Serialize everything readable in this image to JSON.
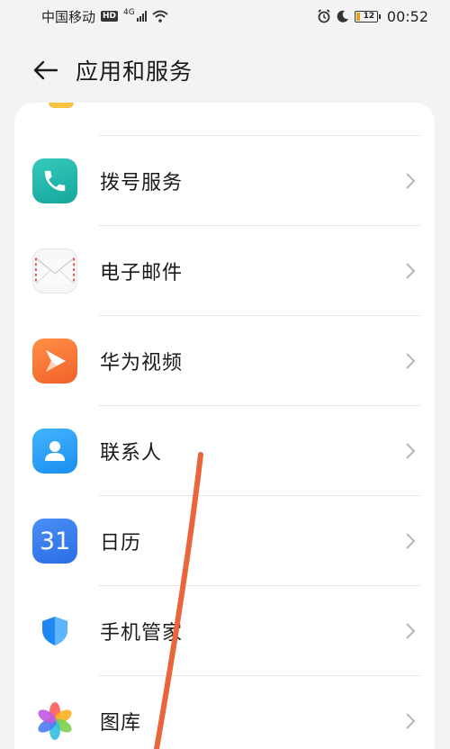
{
  "status_bar": {
    "carrier": "中国移动",
    "network_badge": "HD",
    "network_type": "4G",
    "battery_level": "12",
    "time": "00:52",
    "icons": [
      "signal-icon",
      "wifi-icon",
      "alarm-icon",
      "moon-icon",
      "battery-icon"
    ]
  },
  "header": {
    "title": "应用和服务",
    "back_icon": "arrow-left-icon"
  },
  "list": {
    "items": [
      {
        "label": "拨号服务",
        "icon": "phone-icon"
      },
      {
        "label": "电子邮件",
        "icon": "email-icon"
      },
      {
        "label": "华为视频",
        "icon": "video-icon"
      },
      {
        "label": "联系人",
        "icon": "contacts-icon"
      },
      {
        "label": "日历",
        "icon": "calendar-icon",
        "icon_text": "31"
      },
      {
        "label": "手机管家",
        "icon": "shield-icon"
      },
      {
        "label": "图库",
        "icon": "gallery-icon"
      }
    ]
  },
  "colors": {
    "background": "#f1f3f5",
    "card": "#ffffff",
    "annotation_stroke": "#e8663a"
  }
}
